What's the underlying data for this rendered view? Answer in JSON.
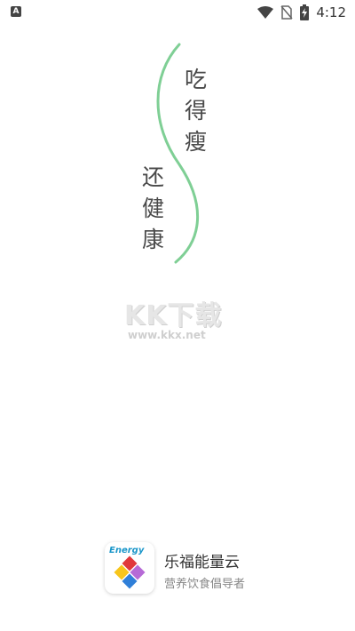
{
  "status_bar": {
    "left_icon": "A",
    "time": "4:12",
    "icons": [
      "wifi-icon",
      "no-sim-icon",
      "battery-charging-icon"
    ]
  },
  "splash": {
    "slogan_line1": [
      "吃",
      "得",
      "瘦"
    ],
    "slogan_line2": [
      "还",
      "健",
      "康"
    ],
    "curve_color": "#7fcf95"
  },
  "watermark": {
    "title": "KK下载",
    "url": "www.kkx.net"
  },
  "brand": {
    "logo_text": "Energy",
    "name": "乐福能量云",
    "slogan": "营养饮食倡导者",
    "logo_colors": [
      "#e0383b",
      "#f7c51b",
      "#2f7fd8",
      "#b66ad6"
    ]
  }
}
